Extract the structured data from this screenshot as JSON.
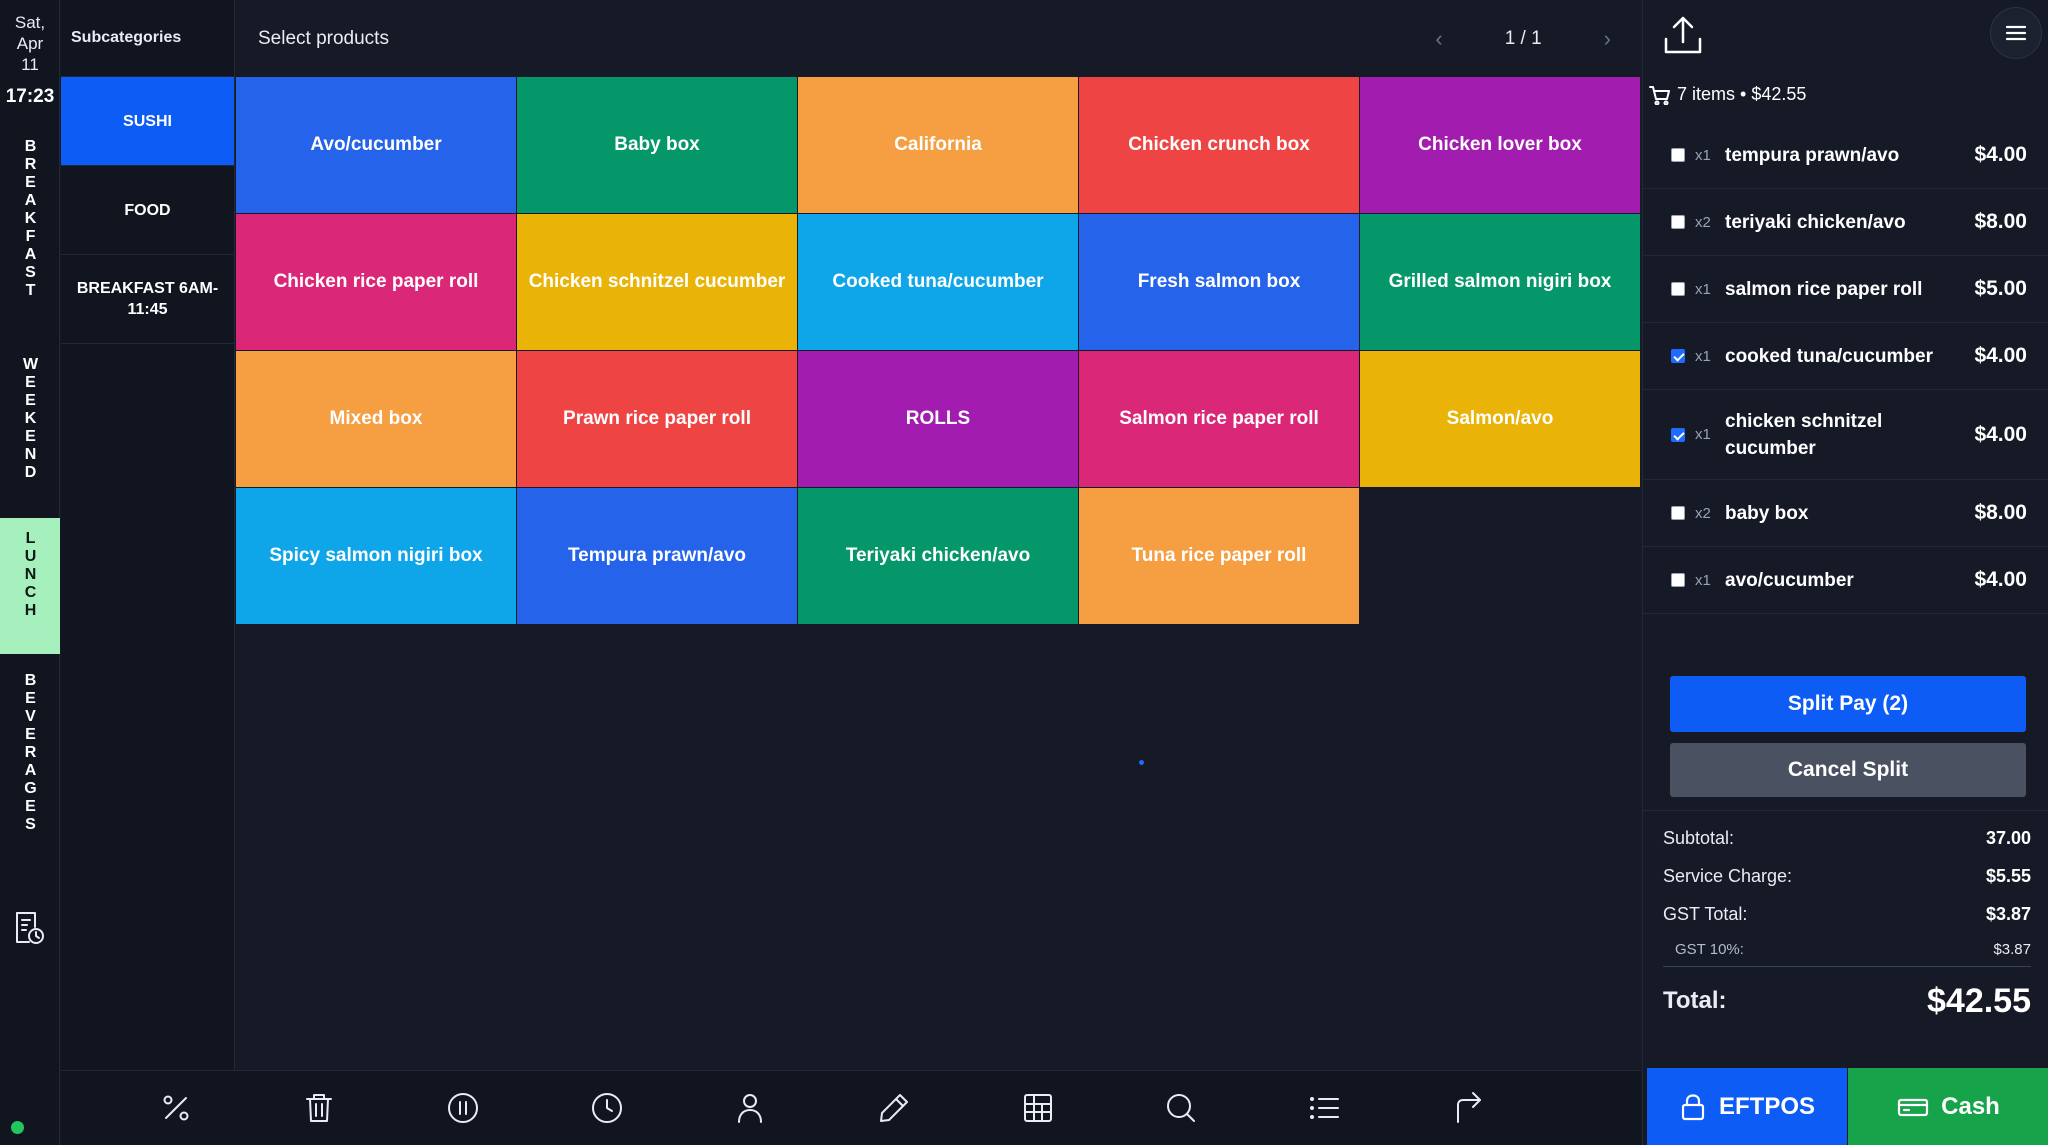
{
  "rail": {
    "date": [
      "Sat,",
      "Apr",
      "11"
    ],
    "time": "17:23",
    "categories": [
      {
        "label": "BREAKFAST",
        "active": false
      },
      {
        "label": "WEEKEND",
        "active": false
      },
      {
        "label": "LUNCH",
        "active": true
      },
      {
        "label": "BEVERAGES",
        "active": false
      }
    ]
  },
  "subcategories": {
    "heading": "Subcategories",
    "items": [
      "SUSHI",
      "FOOD",
      "BREAKFAST 6AM-11:45"
    ],
    "active": "SUSHI"
  },
  "products": {
    "heading": "Select products",
    "page": "1 / 1",
    "prev_icon": "‹",
    "next_icon": "›",
    "tiles": [
      {
        "label": "Avo/cucumber",
        "color": "#2563eb"
      },
      {
        "label": "Baby box",
        "color": "#059669"
      },
      {
        "label": "California",
        "color": "#f59e42"
      },
      {
        "label": "Chicken crunch box",
        "color": "#ef4444"
      },
      {
        "label": "Chicken lover box",
        "color": "#a21caf"
      },
      {
        "label": "Chicken rice paper roll",
        "color": "#db2777"
      },
      {
        "label": "Chicken schnitzel cucumber",
        "color": "#eab308"
      },
      {
        "label": "Cooked tuna/cucumber",
        "color": "#0ea5e9"
      },
      {
        "label": "Fresh salmon box",
        "color": "#2563eb"
      },
      {
        "label": "Grilled salmon nigiri box",
        "color": "#059669"
      },
      {
        "label": "Mixed box",
        "color": "#f59e42"
      },
      {
        "label": "Prawn rice paper roll",
        "color": "#ef4444"
      },
      {
        "label": "ROLLS",
        "color": "#a21caf"
      },
      {
        "label": "Salmon rice paper roll",
        "color": "#db2777"
      },
      {
        "label": "Salmon/avo",
        "color": "#eab308"
      },
      {
        "label": "Spicy salmon nigiri box",
        "color": "#0ea5e9"
      },
      {
        "label": "Tempura prawn/avo",
        "color": "#2563eb"
      },
      {
        "label": "Teriyaki chicken/avo",
        "color": "#059669"
      },
      {
        "label": "Tuna rice paper roll",
        "color": "#f59e42"
      }
    ]
  },
  "toolbar": {
    "icons": [
      "percent-icon",
      "trash-icon",
      "pause-icon",
      "clock-icon",
      "user-icon",
      "pencil-icon",
      "table-icon",
      "search-icon",
      "list-icon",
      "redirect-icon"
    ]
  },
  "order": {
    "summary": "7 items • $42.55",
    "lines": [
      {
        "qty": "x1",
        "name": "tempura prawn/avo",
        "price": "$4.00",
        "checked": false
      },
      {
        "qty": "x2",
        "name": "teriyaki chicken/avo",
        "price": "$8.00",
        "checked": false
      },
      {
        "qty": "x1",
        "name": "salmon rice paper roll",
        "price": "$5.00",
        "checked": false
      },
      {
        "qty": "x1",
        "name": "cooked tuna/cucumber",
        "price": "$4.00",
        "checked": true
      },
      {
        "qty": "x1",
        "name": "chicken schnitzel cucumber",
        "price": "$4.00",
        "checked": true
      },
      {
        "qty": "x2",
        "name": "baby box",
        "price": "$8.00",
        "checked": false
      },
      {
        "qty": "x1",
        "name": "avo/cucumber",
        "price": "$4.00",
        "checked": false
      }
    ],
    "split_label": "Split Pay (2)",
    "cancel_label": "Cancel Split",
    "totals": {
      "subtotal_label": "Subtotal:",
      "subtotal": "37.00",
      "service_label": "Service Charge:",
      "service": "$5.55",
      "gst_label": "GST Total:",
      "gst": "$3.87",
      "gst10_label": "GST 10%:",
      "gst10": "$3.87",
      "total_label": "Total:",
      "total": "$42.55"
    },
    "eftpos_label": "EFTPOS",
    "cash_label": "Cash"
  },
  "colors": {
    "accent": "#0c5cf5",
    "active_category": "#a6f0bd",
    "cash": "#16a34a",
    "cancel": "#4a5161"
  }
}
